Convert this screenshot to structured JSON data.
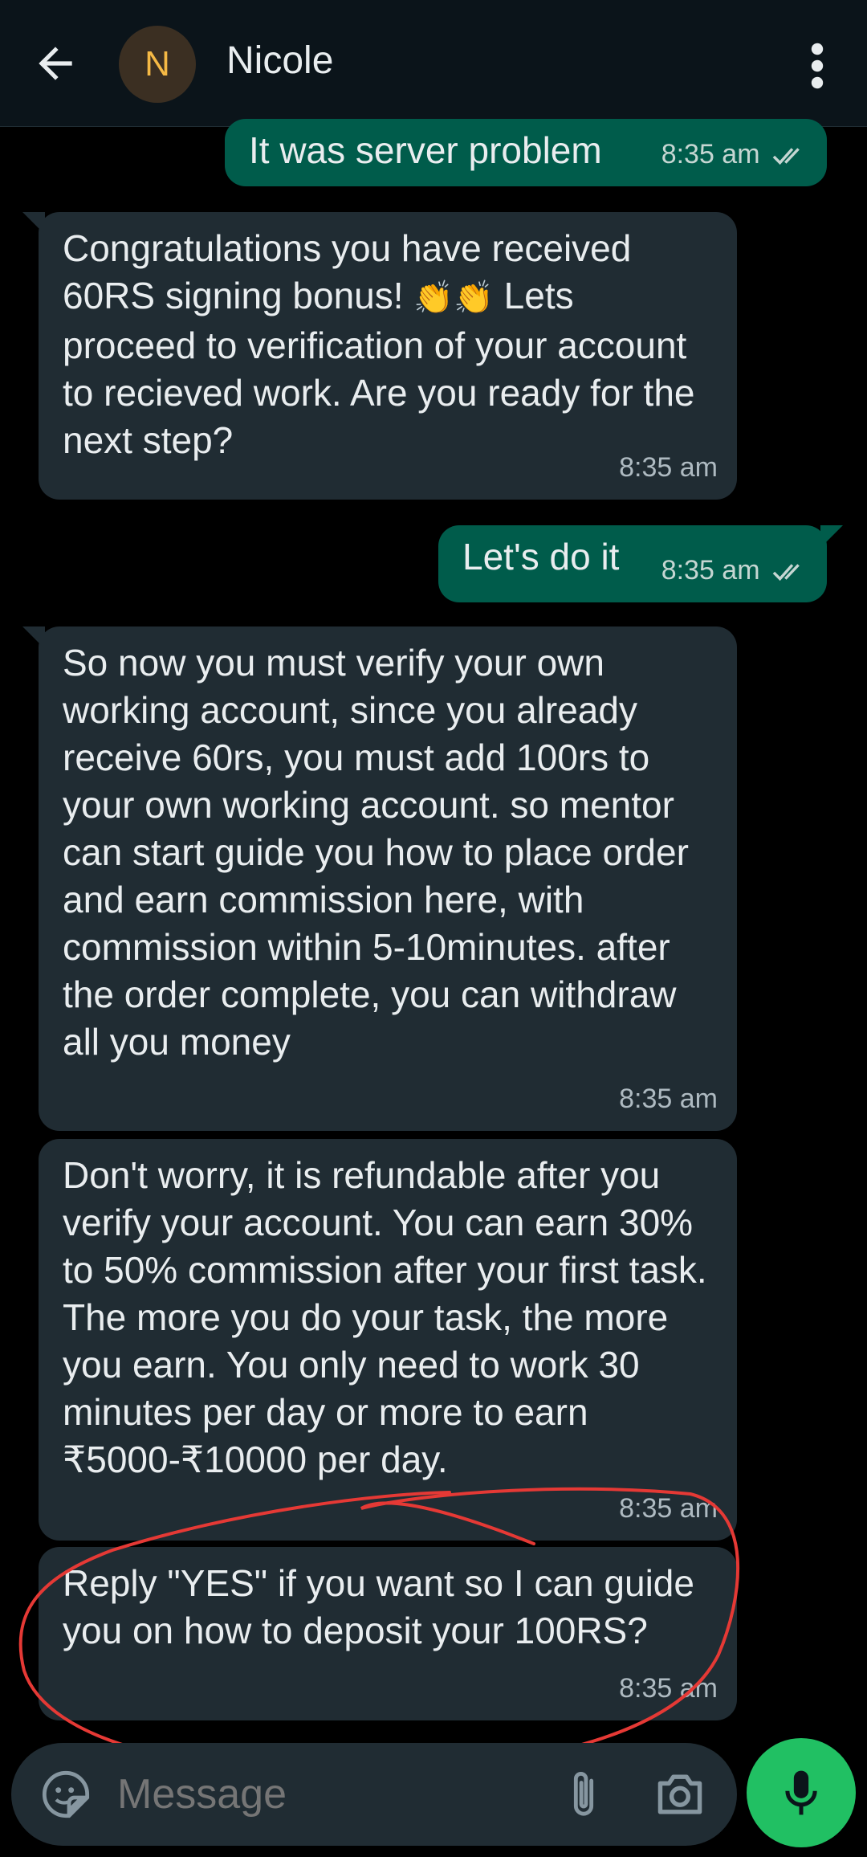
{
  "header": {
    "back_icon": "arrow-left-icon",
    "avatar_initial": "N",
    "contact_name": "Nicole",
    "menu_icon": "kebab-menu-icon"
  },
  "messages": [
    {
      "direction": "out",
      "text": "It was server problem",
      "time": "8:35 am",
      "status_icon": "double-check-icon"
    },
    {
      "direction": "in",
      "text_before": "Congratulations you have received 60RS signing bonus! ",
      "emoji": "👏👏",
      "text_after": " Lets proceed to verification of your account to recieved work.  Are you ready for the next step?",
      "time": "8:35 am"
    },
    {
      "direction": "out",
      "text": "Let's do it",
      "time": "8:35 am",
      "status_icon": "double-check-icon"
    },
    {
      "direction": "in",
      "text": "So now you must verify your own working account, since you already receive 60rs, you must add 100rs to your own working account. so mentor can start guide you how to place order and earn commission here, with commission within 5-10minutes. after the order complete, you can withdraw all you money",
      "time": "8:35 am"
    },
    {
      "direction": "in",
      "text": "Don't worry, it is refundable after you verify your account. You can earn 30% to 50% commission after your first task. The more you do your task, the more you earn. You only need to work 30 minutes per day or more to earn ₹5000-₹10000 per day.",
      "time": "8:35 am"
    },
    {
      "direction": "in",
      "text": "Reply \"YES\" if you want so I can guide you on how to deposit your 100RS?",
      "time": "8:35 am"
    }
  ],
  "composer": {
    "placeholder": "Message",
    "icons": [
      "sticker-icon",
      "attach-icon",
      "camera-icon",
      "mic-icon"
    ]
  },
  "colors": {
    "header_bg": "#0b141a",
    "incoming_bubble": "#202c33",
    "outgoing_bubble": "#005c4b",
    "mic_button": "#21c063",
    "annotation": "#e53935",
    "avatar_text": "#f5b945"
  }
}
